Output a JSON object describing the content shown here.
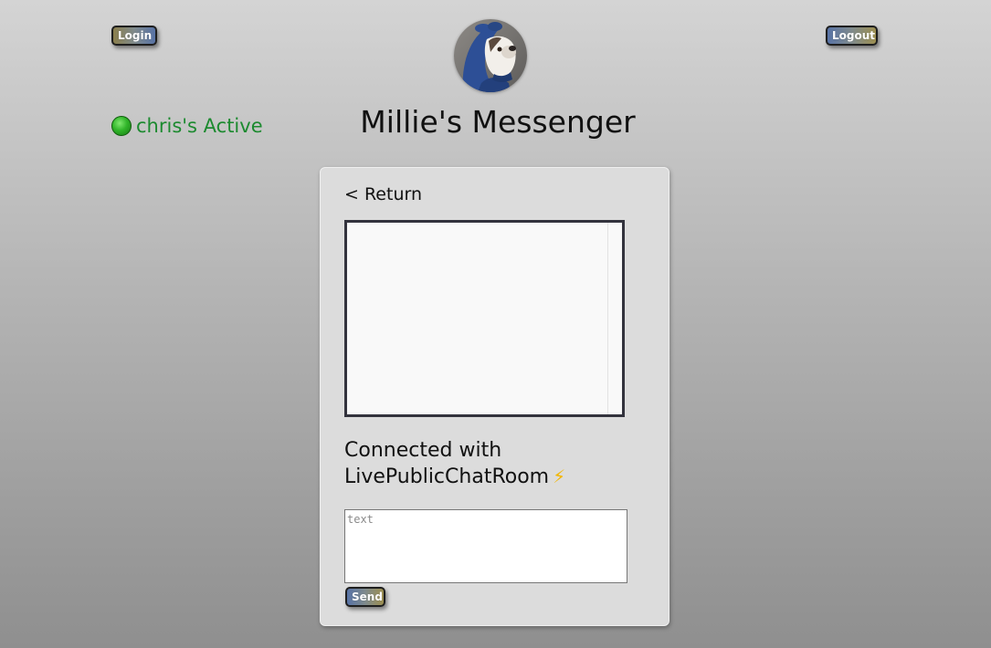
{
  "header": {
    "login_label": "Login",
    "logout_label": "Logout",
    "app_title": "Millie's Messenger",
    "avatar_icon": "dog-avatar-photo"
  },
  "user_status": {
    "text": "chris's Active",
    "indicator_icon": "green-circle-icon",
    "color": "#1c8a2f"
  },
  "chat": {
    "return_label": "< Return",
    "connected_line1": "Connected with",
    "connected_line2": "LivePublicChatRoom",
    "connected_icon": "⚡",
    "input_placeholder": "text",
    "input_value": "",
    "send_label": "Send",
    "messages": []
  }
}
